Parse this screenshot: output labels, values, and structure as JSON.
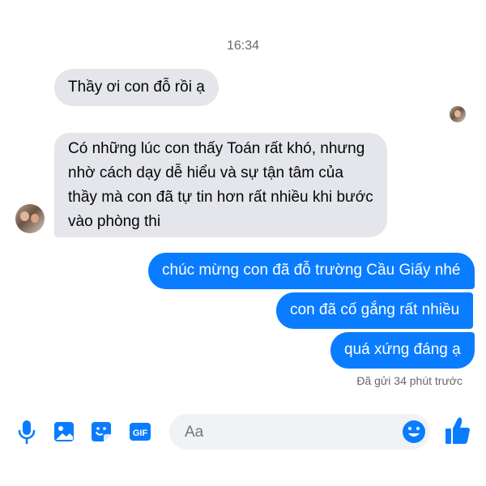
{
  "thread": {
    "timestamp": "16:34",
    "messages": [
      {
        "direction": "incoming",
        "text": "Thầy ơi con đỗ rồi ạ"
      },
      {
        "direction": "incoming",
        "text": "Có những lúc con thấy Toán rất khó, nhưng nhờ cách dạy dễ hiểu và sự tận tâm của thầy mà con đã tự tin hơn rất nhiều khi bước vào phòng thi"
      },
      {
        "direction": "outgoing",
        "text": "chúc mừng con đã đỗ trường Cầu Giấy nhé"
      },
      {
        "direction": "outgoing",
        "text": "con đã cố gắng rất nhiều"
      },
      {
        "direction": "outgoing",
        "text": "quá xứng đáng ạ"
      }
    ],
    "sent_status": "Đã gửi 34 phút trước"
  },
  "composer": {
    "placeholder": "Aa",
    "icons": [
      "microphone-icon",
      "image-icon",
      "sticker-icon",
      "gif-icon",
      "emoji-icon",
      "like-icon"
    ],
    "gif_label": "GIF"
  },
  "colors": {
    "accent": "#0a7cff",
    "incoming_bubble": "#e4e6eb",
    "muted_text": "#65676b"
  }
}
